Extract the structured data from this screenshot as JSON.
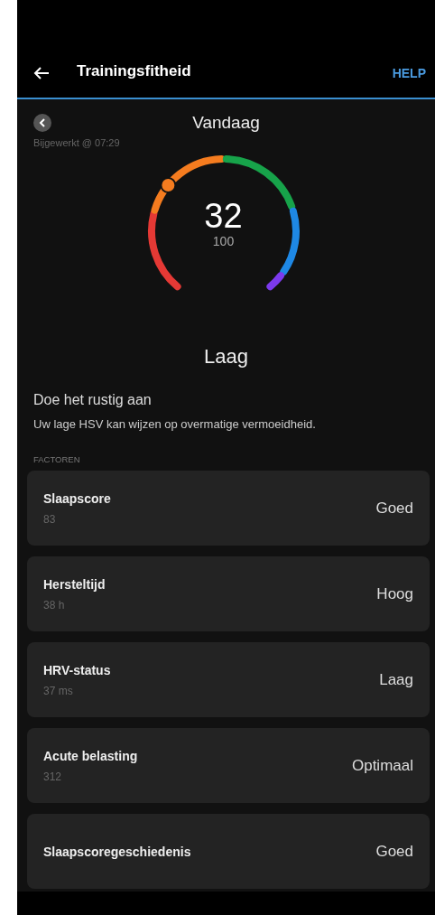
{
  "header": {
    "title": "Trainingsfitheid",
    "action": "HELP"
  },
  "day_nav": {
    "label": "Vandaag"
  },
  "updated": "Bijgewerkt @ 07:29",
  "gauge": {
    "score": "32",
    "max": "100",
    "segments": [
      {
        "color": "#e53935"
      },
      {
        "color": "#f57c1f"
      },
      {
        "color": "#17a34a"
      },
      {
        "color": "#1e88e5"
      },
      {
        "color": "#7c3aed"
      }
    ]
  },
  "status": "Laag",
  "advice": {
    "title": "Doe het rustig aan",
    "text": "Uw lage HSV kan wijzen op overmatige vermoeidheid."
  },
  "factors_heading": "FACTOREN",
  "factors": [
    {
      "name": "Slaapscore",
      "detail": "83",
      "rating": "Goed"
    },
    {
      "name": "Hersteltijd",
      "detail": "38 h",
      "rating": "Hoog"
    },
    {
      "name": "HRV-status",
      "detail": "37 ms",
      "rating": "Laag"
    },
    {
      "name": "Acute belasting",
      "detail": "312",
      "rating": "Optimaal"
    },
    {
      "name": "Slaapscoregeschiedenis",
      "rating": "Goed"
    }
  ]
}
